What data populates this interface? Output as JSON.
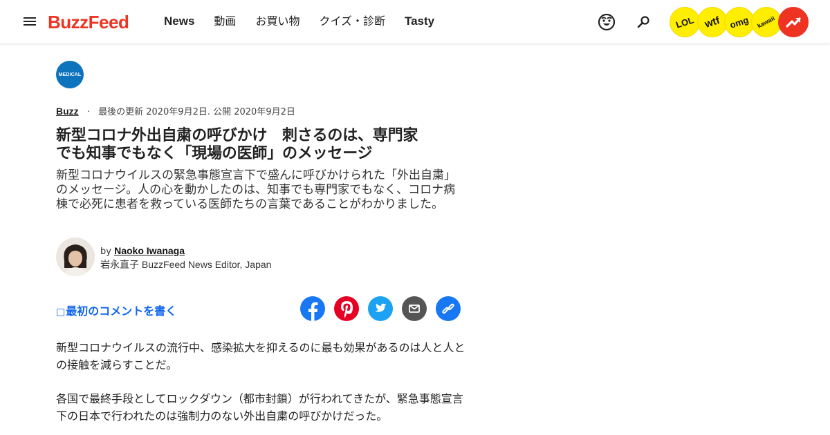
{
  "header": {
    "logo": "BuzzFeed",
    "nav": [
      "News",
      "動画",
      "お買い物",
      "クイズ・診断",
      "Tasty"
    ],
    "badges": [
      "LOL",
      "wtf",
      "omg",
      "kawaii"
    ],
    "trending_icon": "trending-arrow-icon",
    "icons": [
      "menu-icon",
      "smiley-icon",
      "search-icon"
    ]
  },
  "article": {
    "vertical_badge": "MEDICAL",
    "category": "Buzz",
    "dates": "最後の更新 2020年9月2日. 公開 2020年9月2日",
    "title_line1": "新型コロナ外出自粛の呼びかけ　刺さるのは、専門家",
    "title_line2": "でも知事でもなく「現場の医師」のメッセージ",
    "subtitle": "新型コロナウイルスの緊急事態宣言下で盛んに呼びかけられた「外出自粛」のメッセージ。人の心を動かしたのは、知事でも専門家でもなく、コロナ病棟で必死に患者を救っている医師たちの言葉であることがわかりました。",
    "byline_prefix": "by",
    "author": "Naoko Iwanaga",
    "author_role": "岩永直子 BuzzFeed News Editor, Japan",
    "comment_cta": "最初のコメントを書く",
    "comment_icon_glyph": "□",
    "share_icons": [
      "facebook-icon",
      "pinterest-icon",
      "twitter-icon",
      "email-icon",
      "link-icon"
    ],
    "paragraphs": [
      "新型コロナウイルスの流行中、感染拡大を抑えるのに最も効果があるのは人と人との接触を減らすことだ。",
      "各国で最終手段としてロックダウン（都市封鎖）が行われてきたが、緊急事態宣言下の日本で行われたのは強制力のない外出自粛の呼びかけだった。"
    ]
  },
  "colors": {
    "brand_red": "#ee3322",
    "badge_yellow": "#ffee00",
    "link_blue": "#0f65ef",
    "medical_blue": "#0d73bd",
    "facebook": "#1877f2",
    "pinterest": "#e60023",
    "twitter": "#1da1f2",
    "email": "#555555",
    "link": "#1877f2"
  }
}
